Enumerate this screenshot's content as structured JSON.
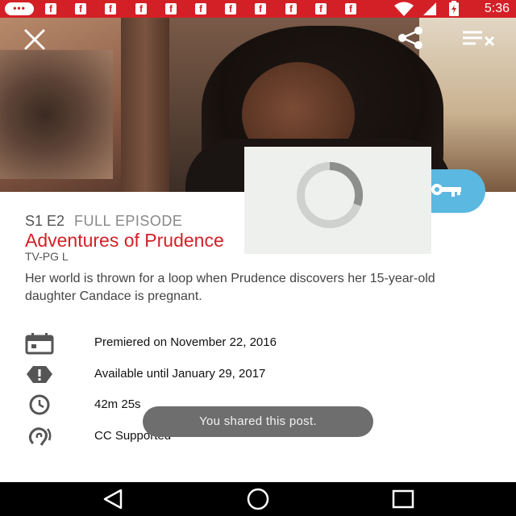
{
  "status_bar": {
    "bubble_text": "•••",
    "app_icons": [
      "f",
      "f",
      "f",
      "f",
      "f",
      "f",
      "f",
      "f",
      "f",
      "f",
      "f"
    ],
    "time": "5:36",
    "color": "#d32027"
  },
  "hero": {
    "close_icon": "close-icon",
    "share_icon": "share-icon",
    "queue_icon": "playlist-remove-icon"
  },
  "episode": {
    "number": "S1 E2",
    "type": "FULL EPISODE",
    "title": "Adventures of Prudence",
    "rating": "TV-PG L",
    "description": "Her world is thrown for a loop when Prudence discovers her 15-year-old daughter Candace is pregnant."
  },
  "details": [
    {
      "icon": "calendar-icon",
      "text": "Premiered on November 22, 2016"
    },
    {
      "icon": "alert-icon",
      "text": "Available until January 29, 2017"
    },
    {
      "icon": "clock-icon",
      "text": "42m 25s"
    },
    {
      "icon": "closed-caption-ear-icon",
      "text": "CC Supported"
    }
  ],
  "toast": {
    "message": "You shared this post."
  },
  "colors": {
    "accent": "#d32027",
    "fab": "#5bb8e0",
    "toast_bg": "#6e6e6e"
  }
}
